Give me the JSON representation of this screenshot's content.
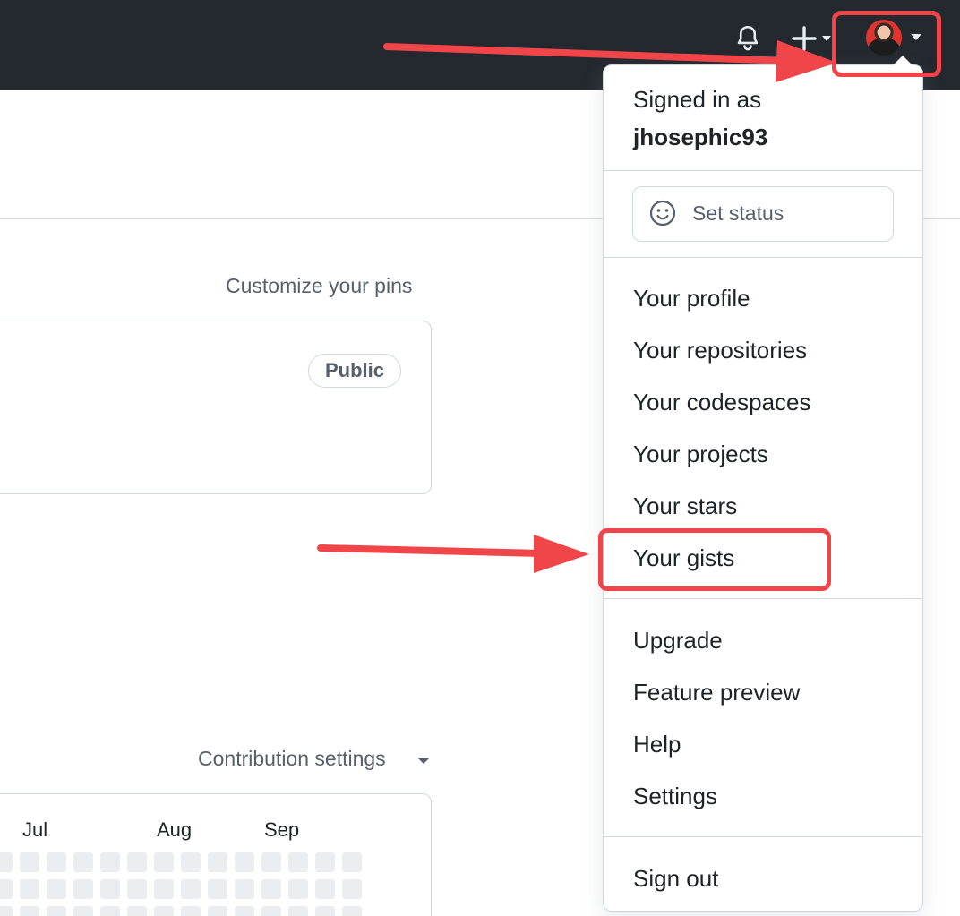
{
  "header": {
    "notification_icon": "bell-icon",
    "create_icon": "plus-icon",
    "avatar_icon": "user-avatar",
    "theme_color": "#24292f"
  },
  "profile": {
    "customize_pins_label": "Customize your pins",
    "pinned_repo": {
      "visibility_badge": "Public"
    },
    "contribution_settings_label": "Contribution settings",
    "contribution_months": [
      "Jul",
      "Aug",
      "Sep"
    ]
  },
  "user_menu": {
    "signed_in_label": "Signed in as",
    "username": "jhosephic93",
    "set_status_label": "Set status",
    "set_status_icon": "smiley-icon",
    "items_primary": [
      "Your profile",
      "Your repositories",
      "Your codespaces",
      "Your projects",
      "Your stars",
      "Your gists"
    ],
    "items_secondary": [
      "Upgrade",
      "Feature preview",
      "Help",
      "Settings"
    ],
    "sign_out_label": "Sign out"
  },
  "annotations": {
    "highlight_color": "#f0464a",
    "highlighted_targets": [
      "avatar-menu-toggle",
      "menu-item-your-gists"
    ]
  }
}
